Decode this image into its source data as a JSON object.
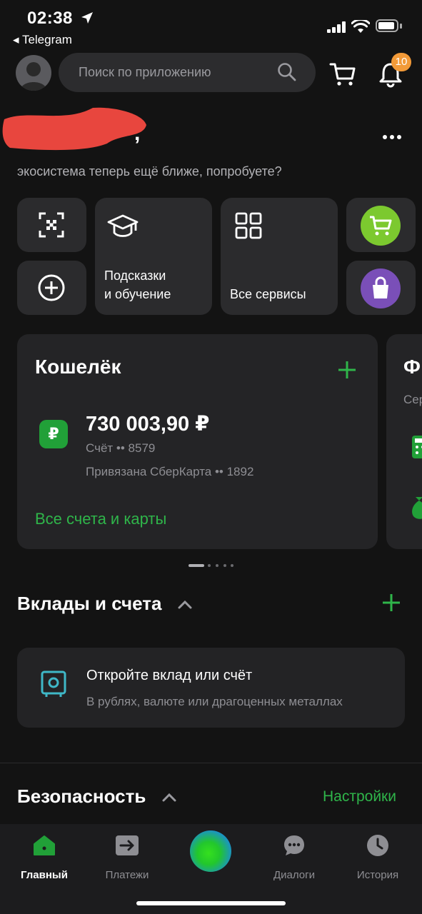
{
  "status": {
    "time": "02:38",
    "back_app": "◂ Telegram"
  },
  "header": {
    "search_placeholder": "Поиск по приложению",
    "notifications_badge": "10"
  },
  "greeting": {
    "comma": ",",
    "subtitle": "экосистема теперь ещё ближе, попробуете?"
  },
  "quick": {
    "tips_label_1": "Подсказки",
    "tips_label_2": "и обучение",
    "services_label": "Все сервисы"
  },
  "wallet": {
    "title": "Кошелёк",
    "balance": "730 003,90 ₽",
    "account": "Счёт •• 8579",
    "linked_card": "Привязана СберКарта •• 1892",
    "all_link": "Все счета и карты",
    "next_card_title": "Ф",
    "next_card_sub": "Сер"
  },
  "deposits": {
    "title": "Вклады и счета",
    "promo_title": "Откройте вклад или счёт",
    "promo_sub": "В рублях, валюте или драгоценных металлах"
  },
  "security": {
    "title": "Безопасность",
    "settings_link": "Настройки"
  },
  "nav": {
    "home": "Главный",
    "payments": "Платежи",
    "dialogs": "Диалоги",
    "history": "История"
  },
  "colors": {
    "accent_green": "#2fb54a",
    "background": "#131313",
    "badge_orange": "#f29a38"
  }
}
